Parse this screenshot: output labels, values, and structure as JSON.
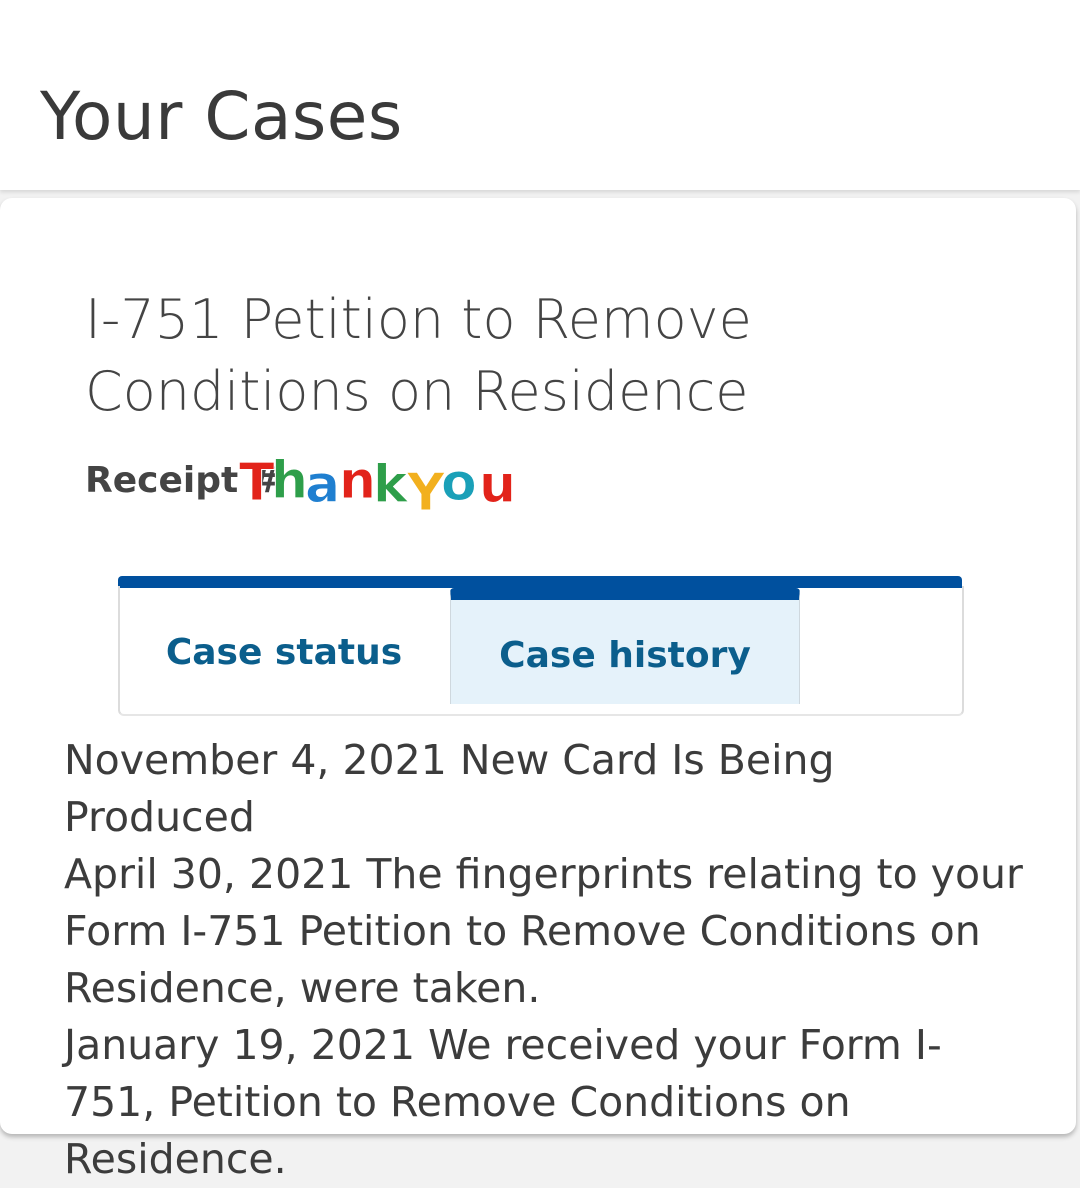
{
  "header": {
    "title": "Your Cases"
  },
  "case": {
    "title": "I-751 Petition to Remove Conditions on Residence",
    "receipt_label": "Receipt #",
    "receipt_sticker_text": "ThankYou"
  },
  "tabs": [
    {
      "label": "Case status",
      "active": false
    },
    {
      "label": "Case history",
      "active": true
    }
  ],
  "history": [
    {
      "text": "November 4, 2021 New Card Is Being Produced"
    },
    {
      "text": "April 30, 2021 The fingerprints relating to your Form I-751 Petition to Remove Conditions on Residence, were taken."
    },
    {
      "text": "January 19, 2021 We received your Form I-751, Petition to Remove Conditions on Residence."
    }
  ],
  "colors": {
    "tab_accent": "#00509e",
    "tab_text": "#0b5e8c",
    "active_tab_bg": "#e5f2fa"
  }
}
